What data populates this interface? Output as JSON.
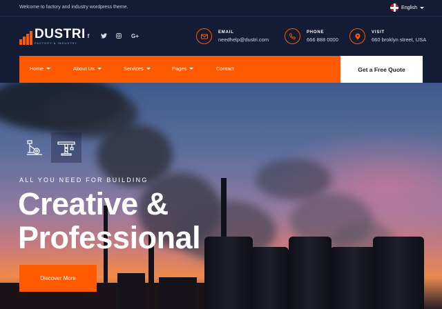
{
  "topbar": {
    "welcome": "Welcome to factory and industry wordpress theme.",
    "language": "English",
    "language_icon": "uk-flag-icon"
  },
  "brand": {
    "name": "DUSTRI",
    "tagline": "FACTORY & INDUSTRY",
    "accent": "#ff5a00",
    "dark": "#141b34"
  },
  "socials": [
    {
      "icon": "facebook-icon",
      "glyph": "f"
    },
    {
      "icon": "twitter-icon",
      "glyph": "t"
    },
    {
      "icon": "instagram-icon",
      "glyph": "◎"
    },
    {
      "icon": "google-plus-icon",
      "glyph": "G+"
    }
  ],
  "contact": {
    "email": {
      "label": "EMAIL",
      "value": "needhelp@dustri.com",
      "icon": "mail-icon"
    },
    "phone": {
      "label": "PHONE",
      "value": "666 888 0000",
      "icon": "phone-icon"
    },
    "visit": {
      "label": "VISIT",
      "value": "660 broklyn street, USA",
      "icon": "map-pin-icon"
    }
  },
  "nav": {
    "items": [
      {
        "label": "Home",
        "dropdown": true
      },
      {
        "label": "About Us",
        "dropdown": true
      },
      {
        "label": "Services",
        "dropdown": true
      },
      {
        "label": "Pages",
        "dropdown": true
      },
      {
        "label": "Contact",
        "dropdown": false
      }
    ],
    "cta": "Get a Free Quote"
  },
  "hero": {
    "icons": [
      "crane-icon",
      "tower-crane-icon"
    ],
    "tagline": "ALL YOU NEED FOR BUILDING",
    "headline_line1": "Creative &",
    "headline_line2": "Professional",
    "button": "Discover More"
  }
}
